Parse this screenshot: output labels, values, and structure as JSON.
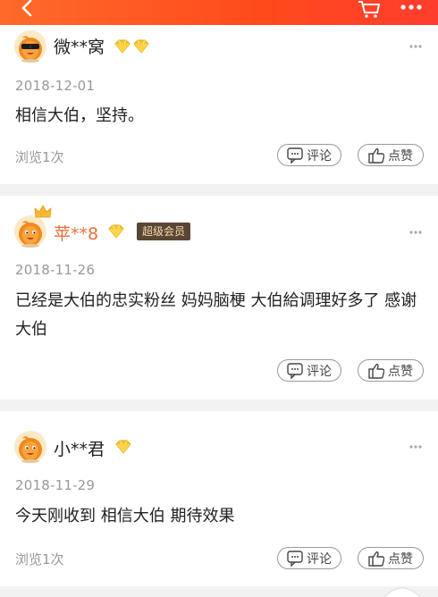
{
  "colors": {
    "header_orange": "#ff4a1c",
    "divider_gray": "#f2f2f2",
    "date_gray": "#999999",
    "vip_badge_bg": "#5a4634",
    "vip_badge_text": "#f4dcb0",
    "diamond_gold": "#f7c52e"
  },
  "header": {
    "icons": [
      "back-arrow-icon",
      "cart-icon",
      "more-icon"
    ]
  },
  "comments": [
    {
      "username": "微**窝",
      "diamond_count": 2,
      "date": "2018-12-01",
      "text": "相信大伯，坚持。",
      "views": "浏览1次",
      "comment_label": "评论",
      "like_label": "点赞"
    },
    {
      "username": "苹**8",
      "diamond_count": 1,
      "badge": "超级会员",
      "has_crown": true,
      "date": "2018-11-26",
      "text": "已经是大伯的忠实粉丝  妈妈脑梗  大伯給调理好多了 感谢大伯",
      "comment_label": "评论",
      "like_label": "点赞"
    },
    {
      "username": "小**君",
      "diamond_count": 1,
      "date": "2018-11-29",
      "text": "今天刚收到  相信大伯 期待效果",
      "views": "浏览1次",
      "comment_label": "评论",
      "like_label": "点赞"
    }
  ]
}
